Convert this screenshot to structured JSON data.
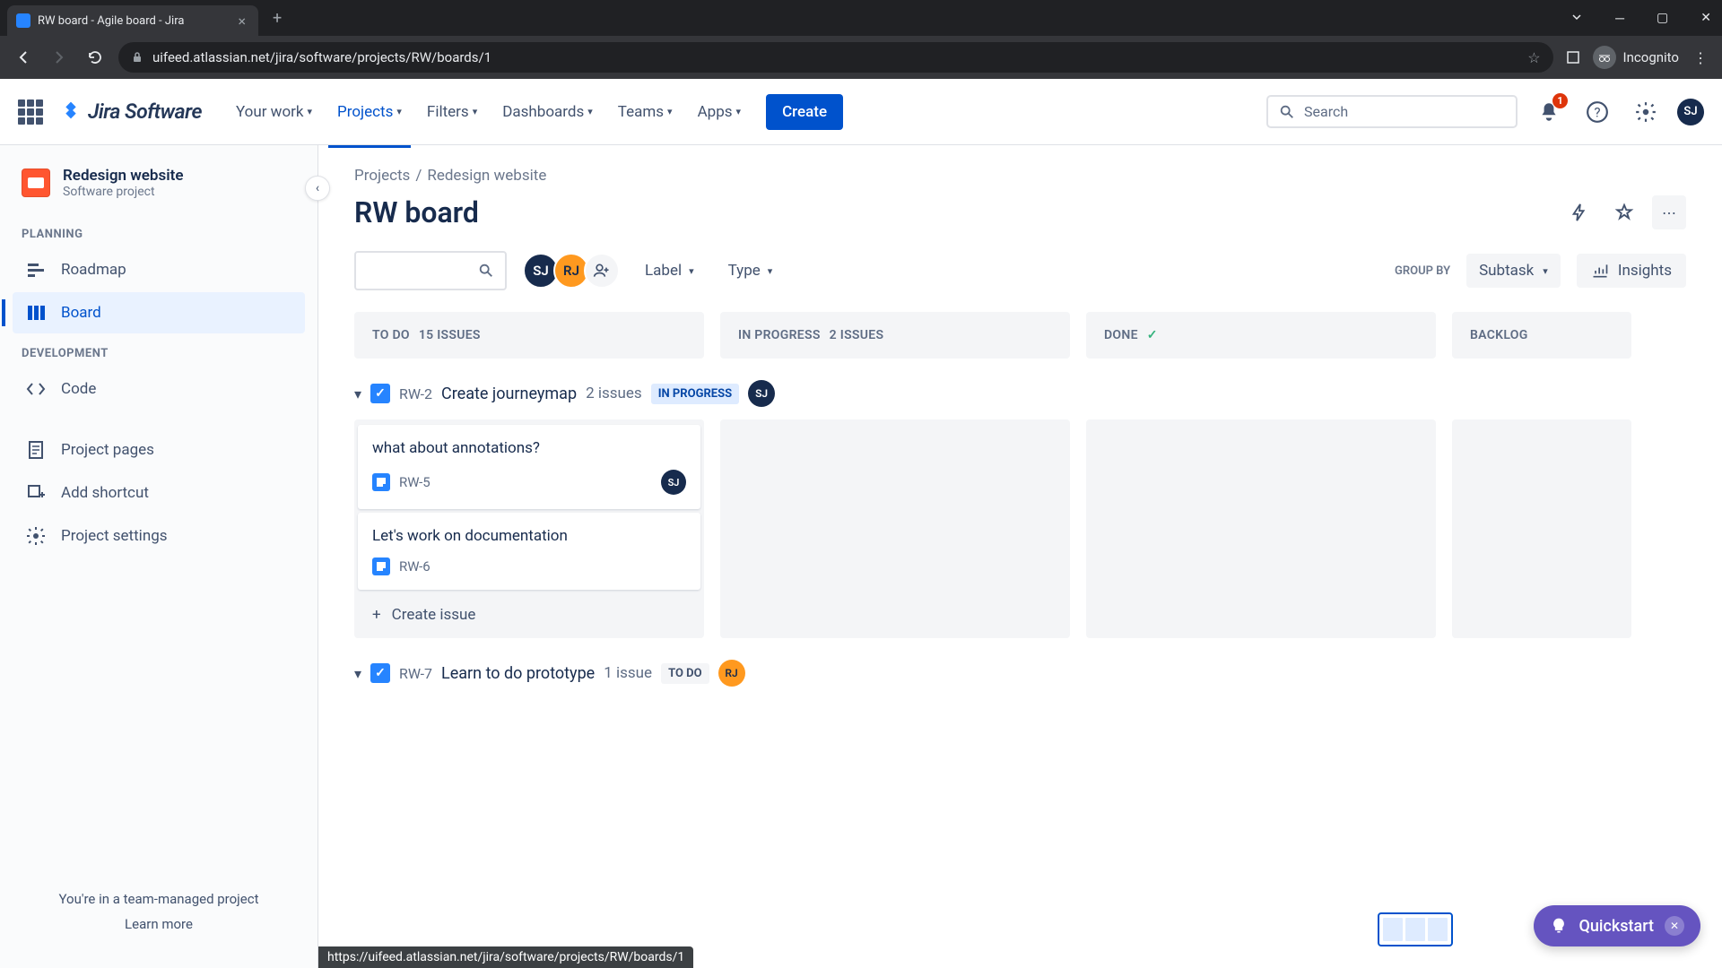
{
  "browser": {
    "tab_title": "RW board - Agile board - Jira",
    "url": "uifeed.atlassian.net/jira/software/projects/RW/boards/1",
    "incognito_label": "Incognito"
  },
  "nav": {
    "product": "Jira Software",
    "items": [
      "Your work",
      "Projects",
      "Filters",
      "Dashboards",
      "Teams",
      "Apps"
    ],
    "active_index": 1,
    "create_label": "Create",
    "search_placeholder": "Search",
    "notification_count": "1",
    "user_initials": "SJ"
  },
  "sidebar": {
    "project_name": "Redesign website",
    "project_type": "Software project",
    "sections": {
      "planning_label": "PLANNING",
      "development_label": "DEVELOPMENT"
    },
    "items": {
      "roadmap": "Roadmap",
      "board": "Board",
      "code": "Code",
      "project_pages": "Project pages",
      "add_shortcut": "Add shortcut",
      "project_settings": "Project settings"
    },
    "footer_text": "You're in a team-managed project",
    "learn_more": "Learn more"
  },
  "breadcrumb": {
    "root": "Projects",
    "sep": "/",
    "project": "Redesign website"
  },
  "board": {
    "title": "RW board",
    "filters": {
      "label": "Label",
      "type": "Type",
      "group_by_label": "GROUP BY",
      "group_by_value": "Subtask",
      "insights": "Insights"
    },
    "avatars": [
      "SJ",
      "RJ"
    ],
    "columns": [
      {
        "name": "TO DO",
        "count": "15 ISSUES"
      },
      {
        "name": "IN PROGRESS",
        "count": "2 ISSUES"
      },
      {
        "name": "DONE",
        "count": ""
      },
      {
        "name": "BACKLOG",
        "count": ""
      }
    ],
    "swimlanes": [
      {
        "key": "RW-2",
        "title": "Create journeymap",
        "count": "2 issues",
        "status": "IN PROGRESS",
        "status_class": "inprogress",
        "assignee": "SJ",
        "assignee_class": "sj",
        "cards_todo": [
          {
            "title": "what about annotations?",
            "key": "RW-5",
            "assignee": "SJ"
          },
          {
            "title": "Let's work on documentation",
            "key": "RW-6",
            "assignee": ""
          }
        ],
        "create_label": "Create issue"
      },
      {
        "key": "RW-7",
        "title": "Learn to do prototype",
        "count": "1 issue",
        "status": "TO DO",
        "status_class": "todo",
        "assignee": "RJ",
        "assignee_class": "rj"
      }
    ]
  },
  "status_url": "https://uifeed.atlassian.net/jira/software/projects/RW/boards/1",
  "quickstart_label": "Quickstart"
}
